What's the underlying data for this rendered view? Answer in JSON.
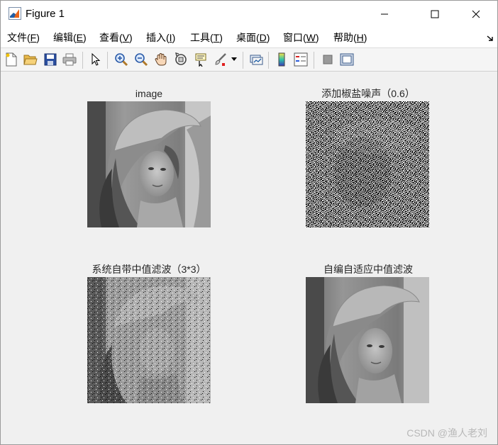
{
  "window": {
    "title": "Figure 1"
  },
  "menu": {
    "items": [
      {
        "text": "文件(",
        "key": "F",
        "close": ")"
      },
      {
        "text": "编辑(",
        "key": "E",
        "close": ")"
      },
      {
        "text": "查看(",
        "key": "V",
        "close": ")"
      },
      {
        "text": "插入(",
        "key": "I",
        "close": ")"
      },
      {
        "text": "工具(",
        "key": "T",
        "close": ")"
      },
      {
        "text": "桌面(",
        "key": "D",
        "close": ")"
      },
      {
        "text": "窗口(",
        "key": "W",
        "close": ")"
      },
      {
        "text": "帮助(",
        "key": "H",
        "close": ")"
      }
    ]
  },
  "toolbar": {
    "icons": [
      "new-figure-icon",
      "open-file-icon",
      "save-icon",
      "print-icon",
      "pointer-icon",
      "zoom-in-icon",
      "zoom-out-icon",
      "pan-icon",
      "rotate-3d-icon",
      "data-cursor-icon",
      "brush-icon",
      "brush-dropdown-icon",
      "link-plot-icon",
      "colorbar-icon",
      "legend-icon",
      "hide-plot-tools-icon",
      "show-plot-tools-icon"
    ]
  },
  "plots": {
    "p1": {
      "title": "image"
    },
    "p2": {
      "title": "添加椒盐噪声（0.6）"
    },
    "p3": {
      "title": "系统自带中值滤波（3*3）"
    },
    "p4": {
      "title": "自编自适应中值滤波"
    }
  },
  "watermark": "CSDN @渔人老刘",
  "colors": {
    "window_bg": "#f0f0f0",
    "titlebar_bg": "#ffffff",
    "matlab_orange": "#e8641b",
    "matlab_blue": "#1f5fa8"
  }
}
